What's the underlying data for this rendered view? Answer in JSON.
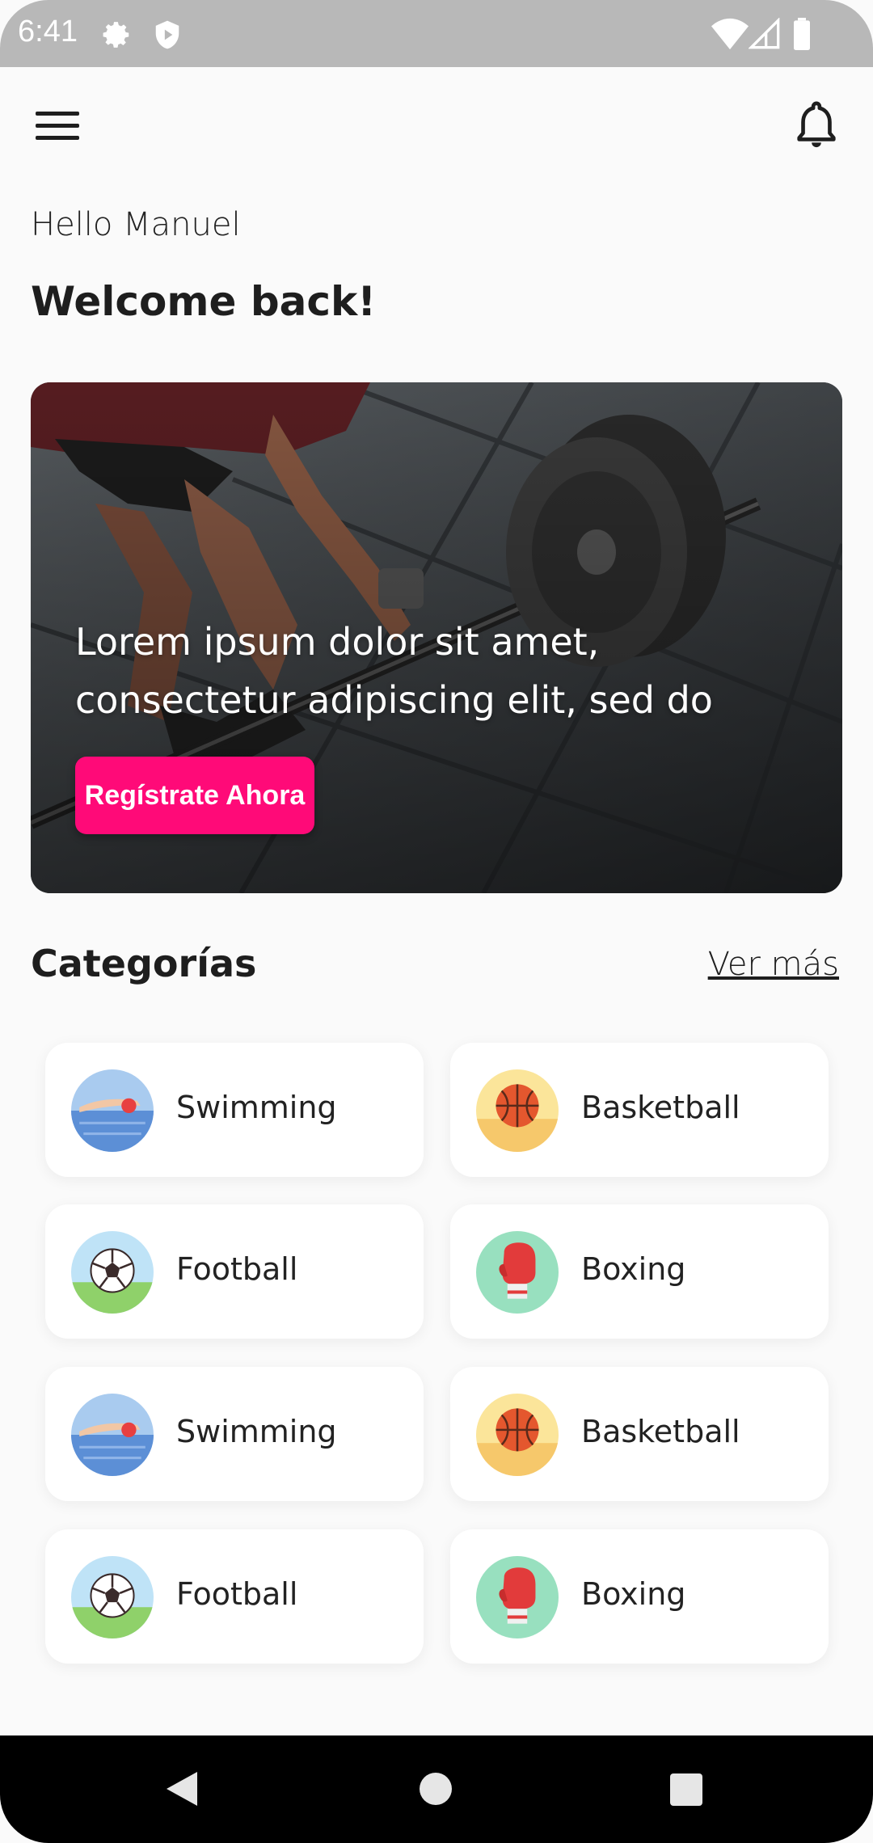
{
  "status_bar": {
    "time": "6:41"
  },
  "header": {
    "greeting": "Hello Manuel",
    "welcome": "Welcome back!"
  },
  "hero": {
    "text": "Lorem ipsum dolor sit amet, consectetur adipiscing elit, sed do",
    "button_label": "Regístrate Ahora"
  },
  "categories": {
    "title": "Categorías",
    "see_more": "Ver más",
    "items": [
      {
        "label": "Swimming",
        "icon": "swimming-icon"
      },
      {
        "label": "Basketball",
        "icon": "basketball-icon"
      },
      {
        "label": "Football",
        "icon": "football-icon"
      },
      {
        "label": "Boxing",
        "icon": "boxing-glove-icon"
      },
      {
        "label": "Swimming",
        "icon": "swimming-icon"
      },
      {
        "label": "Basketball",
        "icon": "basketball-icon"
      },
      {
        "label": "Football",
        "icon": "football-icon"
      },
      {
        "label": "Boxing",
        "icon": "boxing-glove-icon"
      }
    ]
  },
  "colors": {
    "accent": "#ff0a78",
    "background": "#fafafa",
    "card": "#ffffff"
  }
}
